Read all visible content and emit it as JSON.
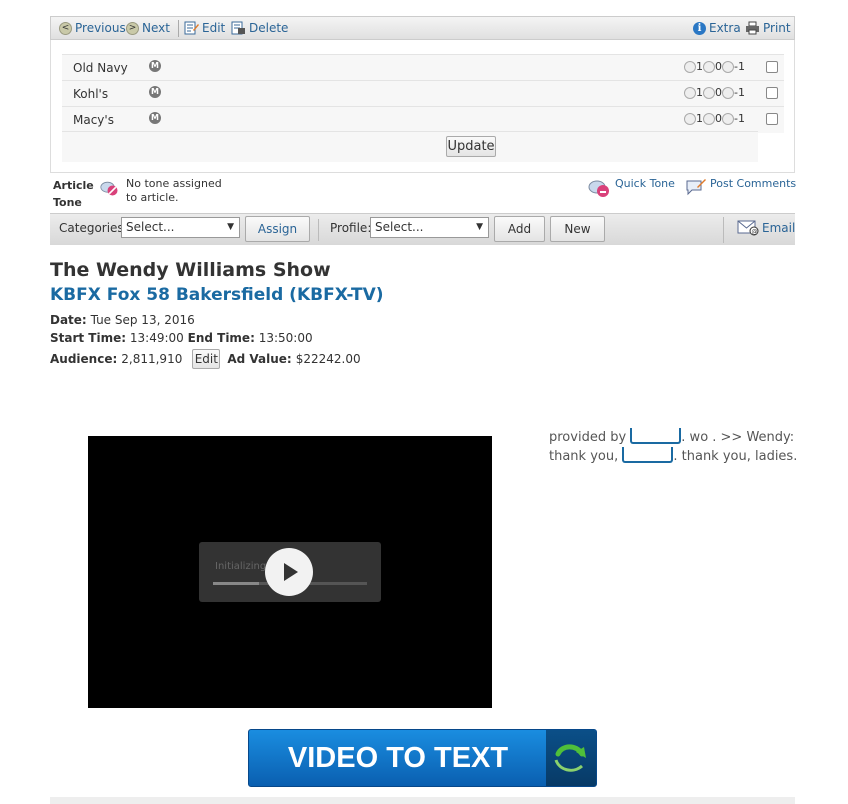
{
  "toolbar": {
    "previous": "Previous",
    "next": "Next",
    "edit": "Edit",
    "delete": "Delete",
    "extra": "Extra",
    "print": "Print"
  },
  "tone_rows": [
    {
      "name": "Old Navy",
      "badge": "M",
      "r1": "1",
      "r2": "0",
      "r3": "-1"
    },
    {
      "name": "Kohl's",
      "badge": "M",
      "r1": "1",
      "r2": "0",
      "r3": "-1"
    },
    {
      "name": "Macy's",
      "badge": "M",
      "r1": "1",
      "r2": "0",
      "r3": "-1"
    }
  ],
  "update_label": "Update",
  "article_tone": {
    "label_line1": "Article",
    "label_line2": "Tone",
    "status_line1": "No tone assigned",
    "status_line2": "to article.",
    "quick_tone": "Quick Tone",
    "post_comments": "Post Comments"
  },
  "catbar": {
    "categories_label": "Categories:",
    "categories_value": "Select...",
    "assign": "Assign",
    "profile_label": "Profile:",
    "profile_value": "Select...",
    "add": "Add",
    "new": "New",
    "email": "Email"
  },
  "article": {
    "title": "The Wendy Williams Show",
    "station": "KBFX Fox 58 Bakersfield (KBFX-TV)",
    "date_label": "Date:",
    "date_value": "Tue Sep 13, 2016",
    "start_label": "Start Time:",
    "start_value": "13:49:00",
    "end_label": "End Time:",
    "end_value": "13:50:00",
    "audience_label": "Audience:",
    "audience_value": "2,811,910",
    "edit_label": "Edit",
    "ad_label": "Ad Value:",
    "ad_value": "$22242.00"
  },
  "video": {
    "status_text": "Initializing"
  },
  "transcript": {
    "part1": "provided by",
    "part2": ". wo . >> Wendy:",
    "part3": "thank you,",
    "part4": ". thank you, ladies."
  },
  "banner": {
    "text": "VIDEO TO TEXT"
  },
  "colors": {
    "link": "#2a6496",
    "station": "#1a6aa2",
    "banner": "#1a8de0"
  }
}
